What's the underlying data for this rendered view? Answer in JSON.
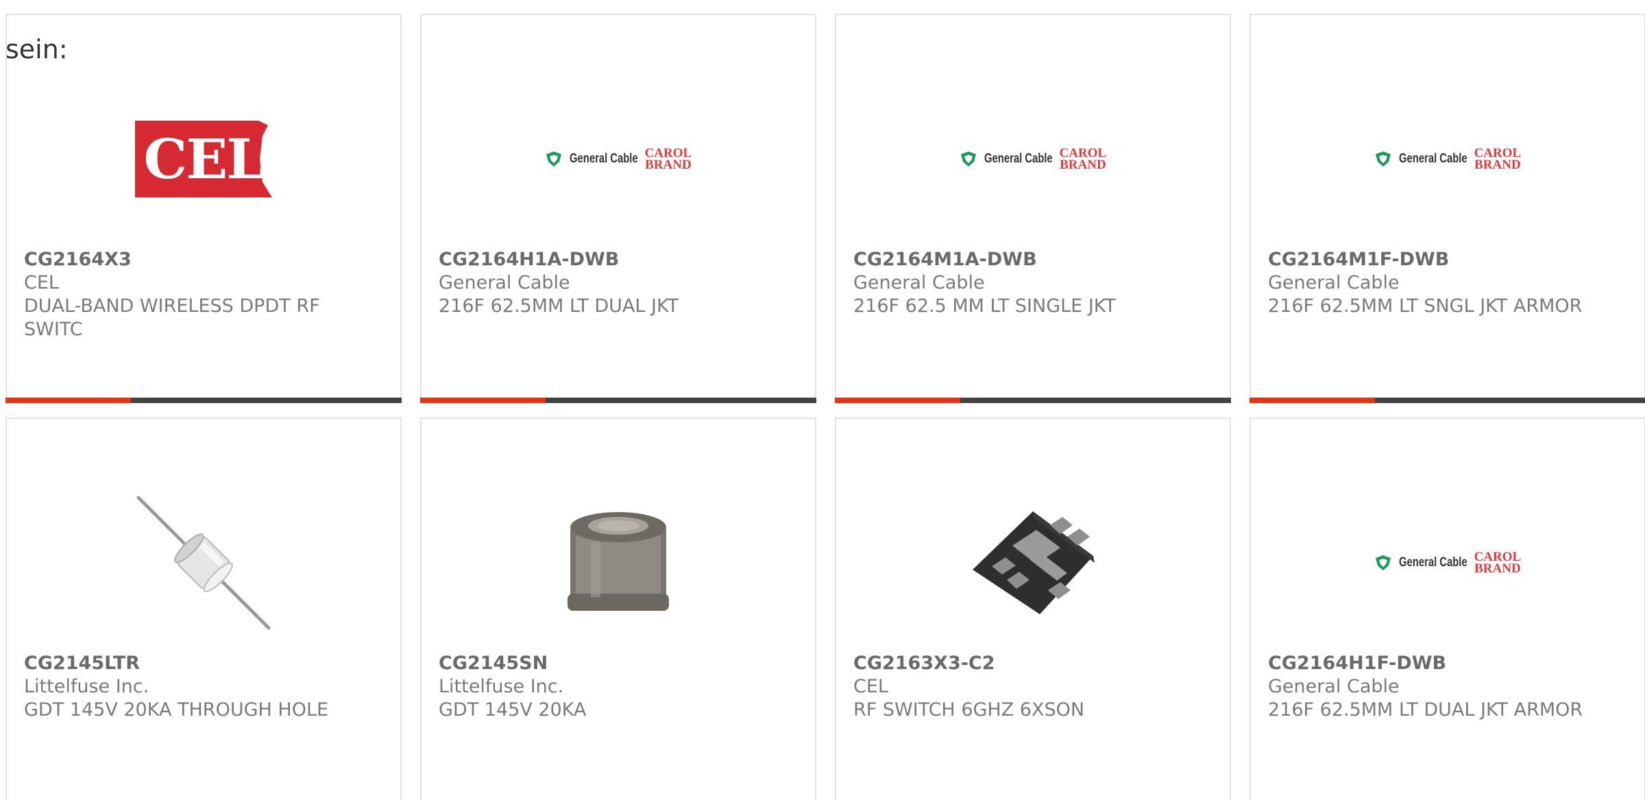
{
  "intro_text": "sein:",
  "colors": {
    "accent": "#e63312",
    "bar": "#444444",
    "card_border": "#e2e2e2",
    "text": "#7a7a7a"
  },
  "general_cable_logo": {
    "name": "General Cable",
    "brand_line1": "CAROL",
    "brand_line2": "BRAND"
  },
  "cel_logo": {
    "text": "CEL"
  },
  "products": [
    {
      "part_number": "CG2164X3",
      "manufacturer": "CEL",
      "description": "DUAL-BAND WIRELESS DPDT RF SWITC",
      "image": "cel-logo"
    },
    {
      "part_number": "CG2164H1A-DWB",
      "manufacturer": "General Cable",
      "description": "216F 62.5MM LT DUAL JKT",
      "image": "general-cable-logo"
    },
    {
      "part_number": "CG2164M1A-DWB",
      "manufacturer": "General Cable",
      "description": "216F 62.5 MM LT SINGLE JKT",
      "image": "general-cable-logo"
    },
    {
      "part_number": "CG2164M1F-DWB",
      "manufacturer": "General Cable",
      "description": "216F 62.5MM LT SNGL JKT ARMOR",
      "image": "general-cable-logo"
    },
    {
      "part_number": "CG2145LTR",
      "manufacturer": "Littelfuse Inc.",
      "description": "GDT 145V 20KA THROUGH HOLE",
      "image": "gdt-axial-photo"
    },
    {
      "part_number": "CG2145SN",
      "manufacturer": "Littelfuse Inc.",
      "description": "GDT 145V 20KA",
      "image": "gdt-cylinder-photo"
    },
    {
      "part_number": "CG2163X3-C2",
      "manufacturer": "CEL",
      "description": "RF SWITCH 6GHZ 6XSON",
      "image": "son-package-photo"
    },
    {
      "part_number": "CG2164H1F-DWB",
      "manufacturer": "General Cable",
      "description": "216F 62.5MM LT DUAL JKT ARMOR",
      "image": "general-cable-logo"
    }
  ]
}
